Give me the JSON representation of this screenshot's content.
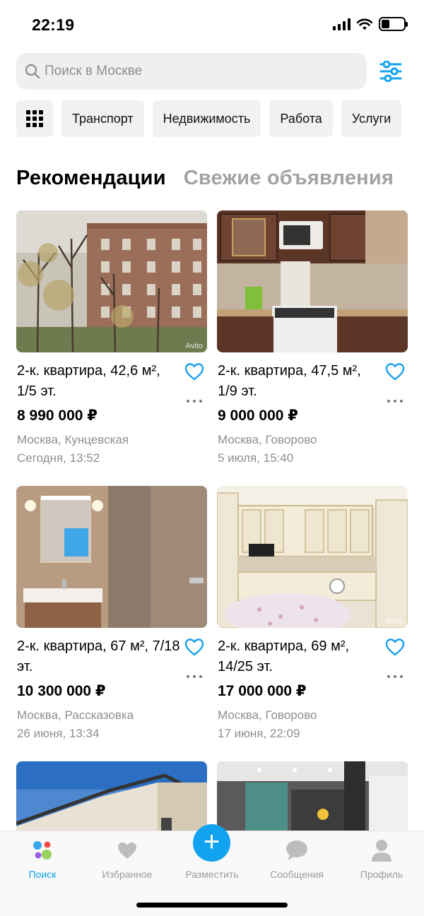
{
  "status_bar": {
    "time": "22:19"
  },
  "search": {
    "placeholder": "Поиск в Москве"
  },
  "categories": [
    "Транспорт",
    "Недвижимость",
    "Работа",
    "Услуги"
  ],
  "tabs": {
    "active": "Рекомендации",
    "inactive": "Свежие объявления"
  },
  "listings": [
    {
      "title": "2-к. квартира, 42,6 м², 1/5 эт.",
      "price": "8 990 000 ₽",
      "location": "Москва, Кунцевская",
      "date": "Сегодня, 13:52",
      "watermark": "Avito"
    },
    {
      "title": "2-к. квартира, 47,5 м², 1/9 эт.",
      "price": "9 000 000 ₽",
      "location": "Москва, Говорово",
      "date": "5 июля, 15:40"
    },
    {
      "title": "2-к. квартира, 67 м², 7/18 эт.",
      "price": "10 300 000 ₽",
      "location": "Москва, Рассказовка",
      "date": "26 июня, 13:34"
    },
    {
      "title": "2-к. квартира, 69 м², 14/25 эт.",
      "price": "17 000 000 ₽",
      "location": "Москва, Говорово",
      "date": "17 июня, 22:09",
      "watermark": "Avito"
    }
  ],
  "bottom_nav": {
    "search": "Поиск",
    "favorites": "Избранное",
    "post": "Разместить",
    "messages": "Сообщения",
    "profile": "Профиль"
  },
  "colors": {
    "accent": "#12a3f0",
    "heart": "#1aa0ea",
    "muted_text": "#8e8e8e",
    "tab_inactive": "#a3a3a3"
  }
}
